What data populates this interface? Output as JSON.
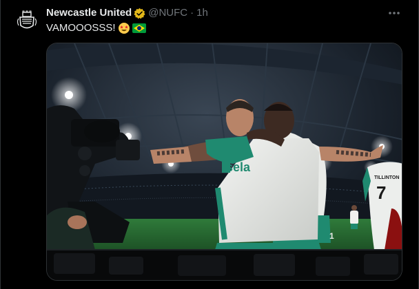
{
  "tweet": {
    "display_name": "Newcastle United",
    "handle": "@NUFC",
    "separator": "·",
    "time": "1h",
    "text": "VAMOOOSSS!",
    "emojis": [
      "star-struck-emoji",
      "brazil-flag-emoji"
    ],
    "media": {
      "sponsor_text": "sela",
      "shirt_name": "TILLINTON",
      "shirt_number": "7"
    }
  },
  "colors": {
    "background": "#000000",
    "primary_text": "#e7e9ea",
    "secondary_text": "#71767b",
    "verified_badge": "#e2b719",
    "border": "#2f3336",
    "kit_green": "#1f8a70"
  }
}
